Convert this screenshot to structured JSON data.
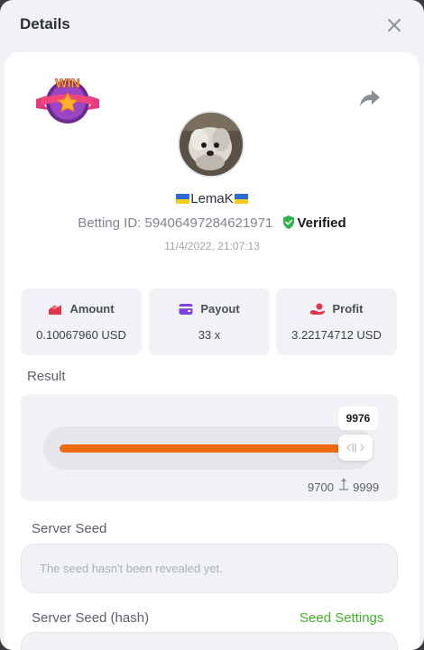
{
  "dialog": {
    "title": "Details"
  },
  "badge": {
    "text": "WIN"
  },
  "user": {
    "name": "LemaK",
    "betting_id_label": "Betting ID:",
    "betting_id": "59406497284621971",
    "verified_label": "Verified",
    "datetime": "11/4/2022, 21:07:13"
  },
  "stats": [
    {
      "label": "Amount",
      "value": "0.10067960 USD",
      "icon": "amount-icon"
    },
    {
      "label": "Payout",
      "value": "33 x",
      "icon": "wallet-icon"
    },
    {
      "label": "Profit",
      "value": "3.22174712 USD",
      "icon": "profit-hand-icon"
    }
  ],
  "result": {
    "label": "Result",
    "value": "9976",
    "range_min": "9700",
    "range_max": "9999",
    "fill_fraction": 0.8
  },
  "server_seed": {
    "label": "Server Seed",
    "placeholder": "The seed hasn't been revealed yet."
  },
  "server_seed_hash": {
    "label": "Server Seed (hash)",
    "settings_link": "Seed Settings"
  },
  "colors": {
    "accent_orange": "#ef6a0e",
    "verified_green": "#2bb24c",
    "link_green": "#43b12d",
    "icon_red": "#e0364a",
    "icon_purple": "#7b3fe4"
  }
}
